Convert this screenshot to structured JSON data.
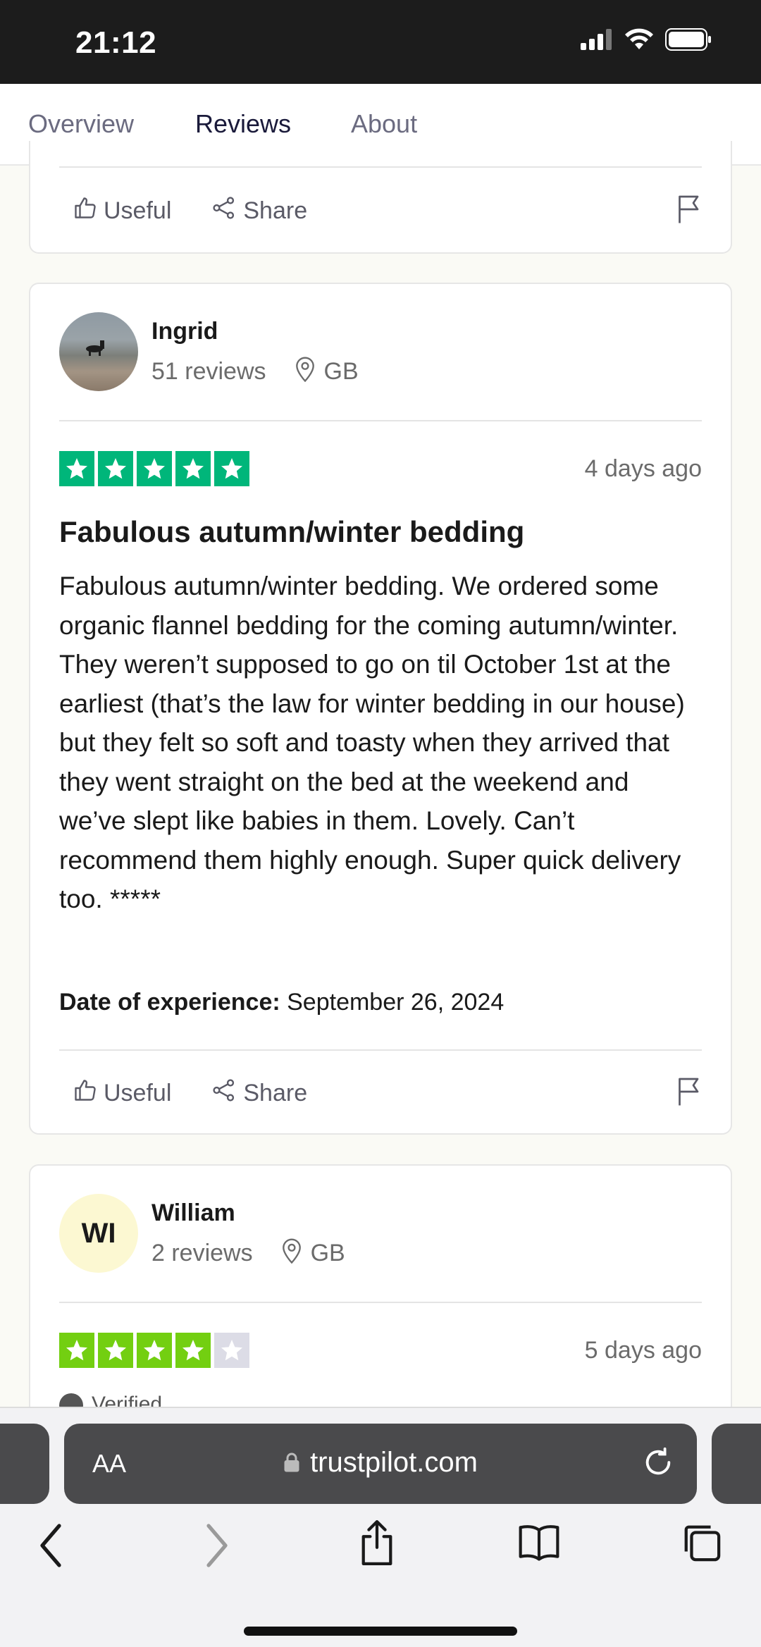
{
  "status_bar": {
    "time": "21:12"
  },
  "tabs": [
    {
      "label": "Overview",
      "active": false
    },
    {
      "label": "Reviews",
      "active": true
    },
    {
      "label": "About",
      "active": false
    }
  ],
  "actions": {
    "useful": "Useful",
    "share": "Share"
  },
  "reviews": [
    {
      "name": "Ingrid",
      "review_count": "51 reviews",
      "country": "GB",
      "rating": 5,
      "star_color": "#00b67a",
      "date": "4 days ago",
      "title": "Fabulous autumn/winter bedding",
      "body": "Fabulous autumn/winter bedding. We ordered some organic flannel bedding for the coming autumn/winter. They weren’t supposed to go on til October 1st at the earliest (that’s the law for winter bedding in our house) but they felt so soft and toasty when they arrived that they went straight on the bed at the weekend and we’ve slept like babies in them. Lovely. Can’t recommend them highly enough. Super quick delivery too. *****",
      "experience_label": "Date of experience:",
      "experience_date": "September 26, 2024"
    },
    {
      "name": "William",
      "initials": "WI",
      "review_count": "2 reviews",
      "country": "GB",
      "rating": 4,
      "star_color": "#73cf11",
      "date": "5 days ago",
      "partial_label": "Verified"
    }
  ],
  "browser": {
    "aa": "AA",
    "url": "trustpilot.com"
  }
}
